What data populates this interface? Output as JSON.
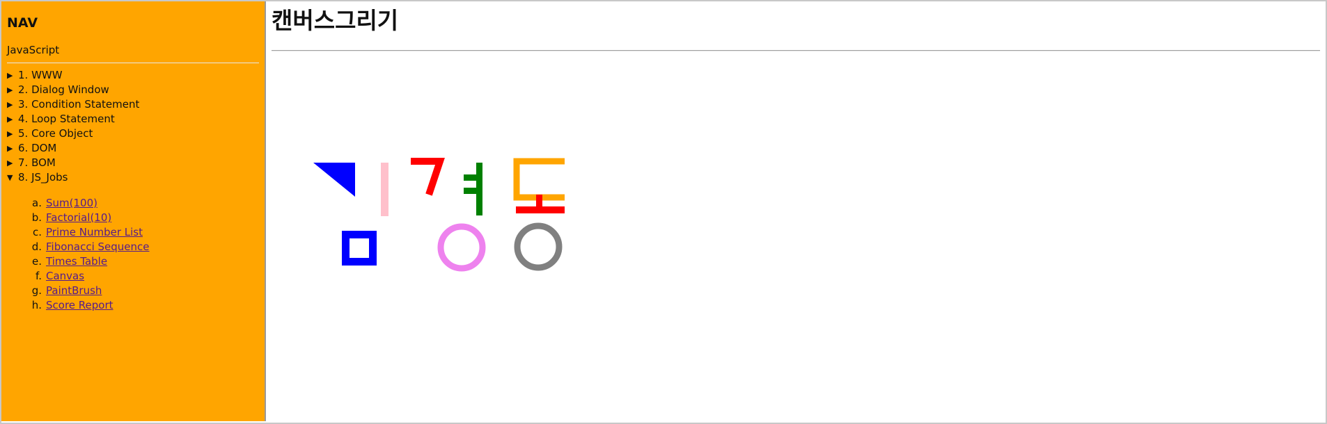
{
  "nav": {
    "title": "NAV",
    "subtitle": "JavaScript",
    "items": [
      {
        "label": "1. WWW",
        "expanded": false
      },
      {
        "label": "2. Dialog Window",
        "expanded": false
      },
      {
        "label": "3. Condition Statement",
        "expanded": false
      },
      {
        "label": "4. Loop Statement",
        "expanded": false
      },
      {
        "label": "5. Core Object",
        "expanded": false
      },
      {
        "label": "6. DOM",
        "expanded": false
      },
      {
        "label": "7. BOM",
        "expanded": false
      },
      {
        "label": "8. JS_Jobs",
        "expanded": true
      }
    ],
    "subitems": [
      {
        "letter": "a.",
        "label": "Sum(100)"
      },
      {
        "letter": "b.",
        "label": "Factorial(10)"
      },
      {
        "letter": "c.",
        "label": "Prime Number List"
      },
      {
        "letter": "d.",
        "label": "Fibonacci Sequence"
      },
      {
        "letter": "e.",
        "label": "Times Table"
      },
      {
        "letter": "f.",
        "label": "Canvas"
      },
      {
        "letter": "g.",
        "label": "PaintBrush"
      },
      {
        "letter": "h.",
        "label": "Score Report"
      }
    ],
    "arrow_collapsed": "▶",
    "arrow_expanded": "▼"
  },
  "main": {
    "title": "캔버스그리기"
  },
  "canvas": {
    "colors": {
      "blue": "#0000ff",
      "pink": "#ffc0cb",
      "red": "#ff0000",
      "green": "#008000",
      "orange": "#ffa500",
      "violet": "#ee82ee",
      "gray": "#808080"
    }
  }
}
